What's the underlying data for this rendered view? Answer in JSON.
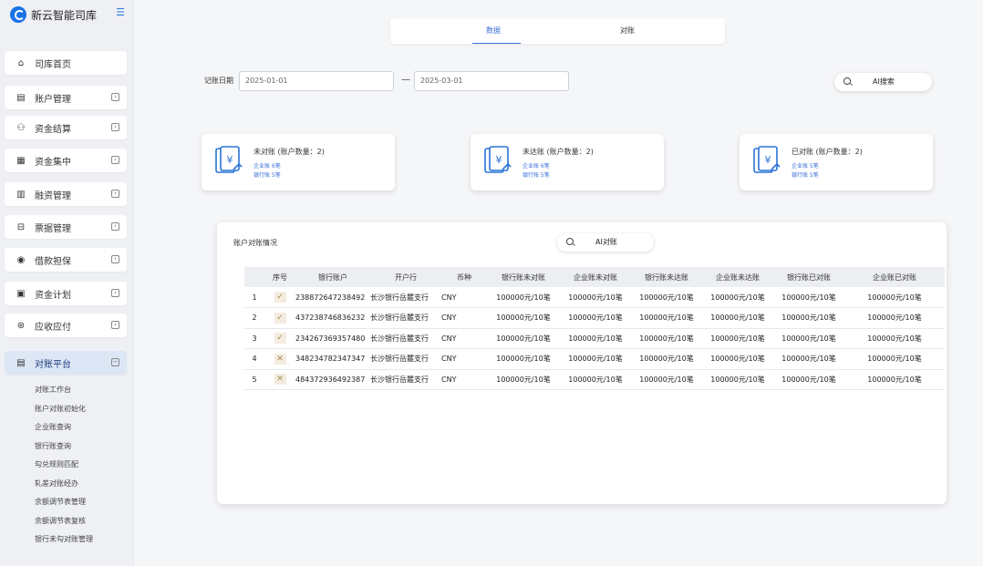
{
  "app": {
    "name": "新云智能司库"
  },
  "sidebar": {
    "items": [
      {
        "label": "司库首页",
        "icon": "home-icon"
      },
      {
        "label": "账户管理",
        "icon": "account-icon"
      },
      {
        "label": "资金结算",
        "icon": "settlement-icon"
      },
      {
        "label": "资金集中",
        "icon": "pooling-icon"
      },
      {
        "label": "融资管理",
        "icon": "financing-icon"
      },
      {
        "label": "票据管理",
        "icon": "bill-icon"
      },
      {
        "label": "借款担保",
        "icon": "guarantee-icon"
      },
      {
        "label": "资金计划",
        "icon": "plan-icon"
      },
      {
        "label": "应收应付",
        "icon": "receivable-icon"
      },
      {
        "label": "对账平台",
        "icon": "reconcile-icon"
      }
    ],
    "sub_items": [
      "对账工作台",
      "账户对账初始化",
      "企业账查询",
      "银行账查询",
      "勾兑规则匹配",
      "轧差对账经办",
      "余额调节表管理",
      "余额调节表复核",
      "银行未勾对账管理"
    ]
  },
  "tabs": [
    "数据",
    "对账"
  ],
  "filter": {
    "label": "记账日期",
    "start": "2025-01-01",
    "end": "2025-03-01",
    "separator": "—",
    "ai_search": "AI搜索"
  },
  "cards": [
    {
      "title": "未对账 (账户数量：2)",
      "line1": "企业账 6笔",
      "line2": "银行账 5笔"
    },
    {
      "title": "未达账 (账户数量：2)",
      "line1": "企业账 6笔",
      "line2": "银行账 5笔"
    },
    {
      "title": "已对账 (账户数量：2)",
      "line1": "企业账 5笔",
      "line2": "银行账 5笔"
    }
  ],
  "panel": {
    "title": "账户对账情况",
    "ai_button": "AI对账",
    "columns": [
      "",
      "序号",
      "银行账户",
      "开户行",
      "币种",
      "银行账未对账",
      "企业账未对账",
      "银行账未达账",
      "企业账未达账",
      "银行账已对账",
      "企业账已对账"
    ],
    "rows": [
      {
        "no": "1",
        "status": "✓",
        "account": "238872647238492",
        "bank": "长沙银行岳麓支行",
        "currency": "CNY",
        "c1": "100000元/10笔",
        "c2": "100000元/10笔",
        "c3": "100000元/10笔",
        "c4": "100000元/10笔",
        "c5": "100000元/10笔",
        "c6": "100000元/10笔"
      },
      {
        "no": "2",
        "status": "✓",
        "account": "437238746836232",
        "bank": "长沙银行岳麓支行",
        "currency": "CNY",
        "c1": "100000元/10笔",
        "c2": "100000元/10笔",
        "c3": "100000元/10笔",
        "c4": "100000元/10笔",
        "c5": "100000元/10笔",
        "c6": "100000元/10笔"
      },
      {
        "no": "3",
        "status": "✓",
        "account": "234267369357480",
        "bank": "长沙银行岳麓支行",
        "currency": "CNY",
        "c1": "100000元/10笔",
        "c2": "100000元/10笔",
        "c3": "100000元/10笔",
        "c4": "100000元/10笔",
        "c5": "100000元/10笔",
        "c6": "100000元/10笔"
      },
      {
        "no": "4",
        "status": "✕",
        "account": "348234782347347",
        "bank": "长沙银行岳麓支行",
        "currency": "CNY",
        "c1": "100000元/10笔",
        "c2": "100000元/10笔",
        "c3": "100000元/10笔",
        "c4": "100000元/10笔",
        "c5": "100000元/10笔",
        "c6": "100000元/10笔"
      },
      {
        "no": "5",
        "status": "✕",
        "account": "484372936492387",
        "bank": "长沙银行岳麓支行",
        "currency": "CNY",
        "c1": "100000元/10笔",
        "c2": "100000元/10笔",
        "c3": "100000元/10笔",
        "c4": "100000元/10笔",
        "c5": "100000元/10笔",
        "c6": "100000元/10笔"
      }
    ]
  }
}
